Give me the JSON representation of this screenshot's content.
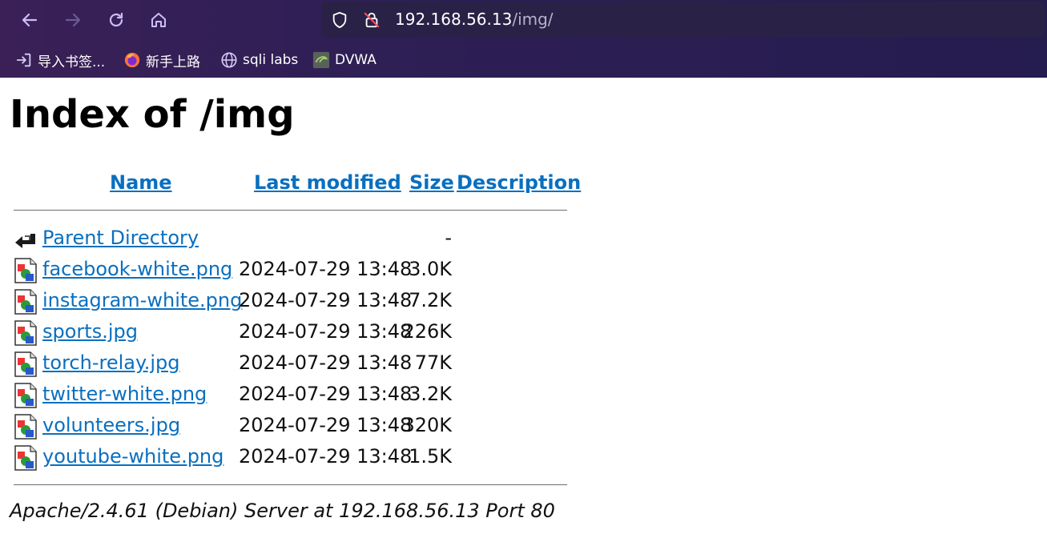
{
  "browser": {
    "url_host": "192.168.56.13",
    "url_path": "/img/",
    "bookmarks": [
      {
        "label": "导入书签...",
        "icon": "import-bookmarks-icon"
      },
      {
        "label": "新手上路",
        "icon": "firefox-icon"
      },
      {
        "label": "sqli labs",
        "icon": "globe-icon"
      },
      {
        "label": "DVWA",
        "icon": "dvwa-icon"
      }
    ]
  },
  "page": {
    "title": "Index of /img",
    "columns": {
      "name": "Name",
      "last_modified": "Last modified",
      "size": "Size",
      "description": "Description"
    },
    "entries": [
      {
        "name": "Parent Directory",
        "date": "",
        "size": "-",
        "icon": "back-arrow-icon"
      },
      {
        "name": "facebook-white.png",
        "date": "2024-07-29 13:48",
        "size": "3.0K",
        "icon": "image-file-icon"
      },
      {
        "name": "instagram-white.png",
        "date": "2024-07-29 13:48",
        "size": "7.2K",
        "icon": "image-file-icon"
      },
      {
        "name": "sports.jpg",
        "date": "2024-07-29 13:48",
        "size": "226K",
        "icon": "image-file-icon"
      },
      {
        "name": "torch-relay.jpg",
        "date": "2024-07-29 13:48",
        "size": "77K",
        "icon": "image-file-icon"
      },
      {
        "name": "twitter-white.png",
        "date": "2024-07-29 13:48",
        "size": "3.2K",
        "icon": "image-file-icon"
      },
      {
        "name": "volunteers.jpg",
        "date": "2024-07-29 13:48",
        "size": "320K",
        "icon": "image-file-icon"
      },
      {
        "name": "youtube-white.png",
        "date": "2024-07-29 13:48",
        "size": "1.5K",
        "icon": "image-file-icon"
      }
    ],
    "footer": "Apache/2.4.61 (Debian) Server at 192.168.56.13 Port 80"
  },
  "colors": {
    "link": "#0a6fbf",
    "chrome_bg": "#2e1f55",
    "urlbar_bg": "#2a2147",
    "nav_icon": "#c7b8f0"
  }
}
